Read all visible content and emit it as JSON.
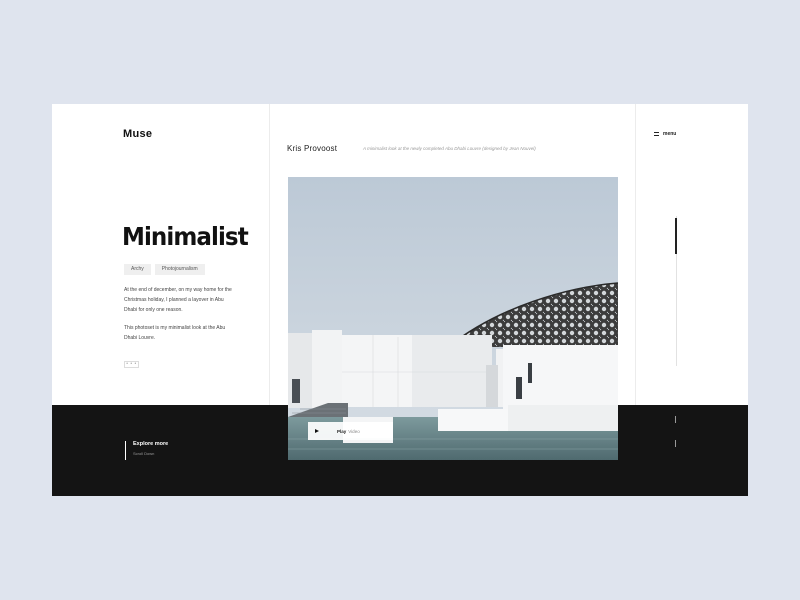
{
  "brand": {
    "logo": "Muse"
  },
  "menu": {
    "label": "menu",
    "icon": "hamburger-icon"
  },
  "article": {
    "title": "Minimalist",
    "tags": [
      "Archy",
      "Photojournalism"
    ],
    "paragraphs": [
      "At the end of december, on my way home for the Christmas holiday, I planned a layover in Abu Dhabi for only one reason.",
      "This photoset is my minimalist look at the Abu Dhabi Louvre."
    ],
    "more_label": "• • •"
  },
  "photo": {
    "author": "Kris Provoost",
    "caption": "A minimalist look at the newly completed Abu Dhabi Louvre (designed by Jean Nouvel)",
    "play_label": "Play",
    "play_suffix": "Video",
    "play_icon": "play-icon"
  },
  "footer": {
    "explore_label": "Explore more",
    "explore_sub": "Scroll Down"
  },
  "colors": {
    "background": "#dfe4ee",
    "card": "#ffffff",
    "band": "#141414",
    "text": "#111111"
  }
}
